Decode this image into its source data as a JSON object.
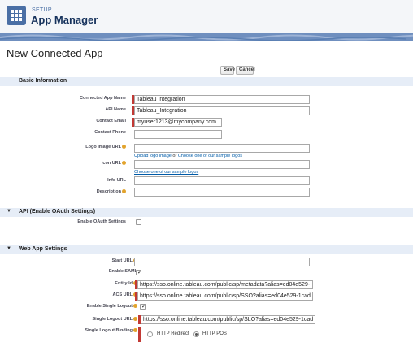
{
  "header": {
    "setup_label": "SETUP",
    "title": "App Manager"
  },
  "page": {
    "title": "New Connected App",
    "save_label": "Save",
    "cancel_label": "Cancel"
  },
  "basic": {
    "section_title": "Basic Information",
    "connected_app_name_label": "Connected App Name",
    "connected_app_name_value": "Tableau Integration",
    "api_name_label": "API Name",
    "api_name_value": "Tableau_Integration",
    "contact_email_label": "Contact Email",
    "contact_email_value": "myuser1213@mycompany.com",
    "contact_phone_label": "Contact Phone",
    "contact_phone_value": "",
    "logo_image_url_label": "Logo Image URL",
    "logo_upload_link": "Upload logo image",
    "logo_or_text": "or",
    "logo_sample_link": "Choose one of our sample logos",
    "icon_url_label": "Icon URL",
    "icon_sample_link": "Choose one of our sample logos",
    "info_url_label": "Info URL",
    "description_label": "Description"
  },
  "api": {
    "section_title": "API (Enable OAuth Settings)",
    "enable_oauth_label": "Enable OAuth Settings",
    "enable_oauth_checked": false
  },
  "webapp": {
    "section_title": "Web App Settings",
    "start_url_label": "Start URL",
    "enable_saml_label": "Enable SAML",
    "enable_saml_checked": true,
    "entity_id_label": "Entity Id",
    "entity_id_value": "https://sso.online.tableau.com/public/sp/metadata?alias=ed04e529-",
    "acs_url_label": "ACS URL",
    "acs_url_value": "https://sso.online.tableau.com/public/sp/SSO?alias=ed04e529-1cad",
    "enable_single_logout_label": "Enable Single Logout",
    "enable_single_logout_checked": true,
    "single_logout_url_label": "Single Logout URL",
    "single_logout_url_value": "https://sso.online.tableau.com/public/sp/SLO?alias=ed04e529-1cad",
    "single_logout_binding_label": "Single Logout Binding",
    "binding_options": [
      "HTTP Redirect",
      "HTTP POST"
    ],
    "binding_selected": "HTTP POST"
  },
  "icons": {
    "app_launcher": "app-grid-icon",
    "section_toggle": "triangle-down-icon",
    "info": "info-icon",
    "checkmark": "checkmark-icon"
  },
  "colors": {
    "brand_tile": "#4a6fa5",
    "required_bar": "#c23934",
    "section_bg": "#e6edf7",
    "link": "#015ba7",
    "info_icon": "#e2a32c"
  }
}
